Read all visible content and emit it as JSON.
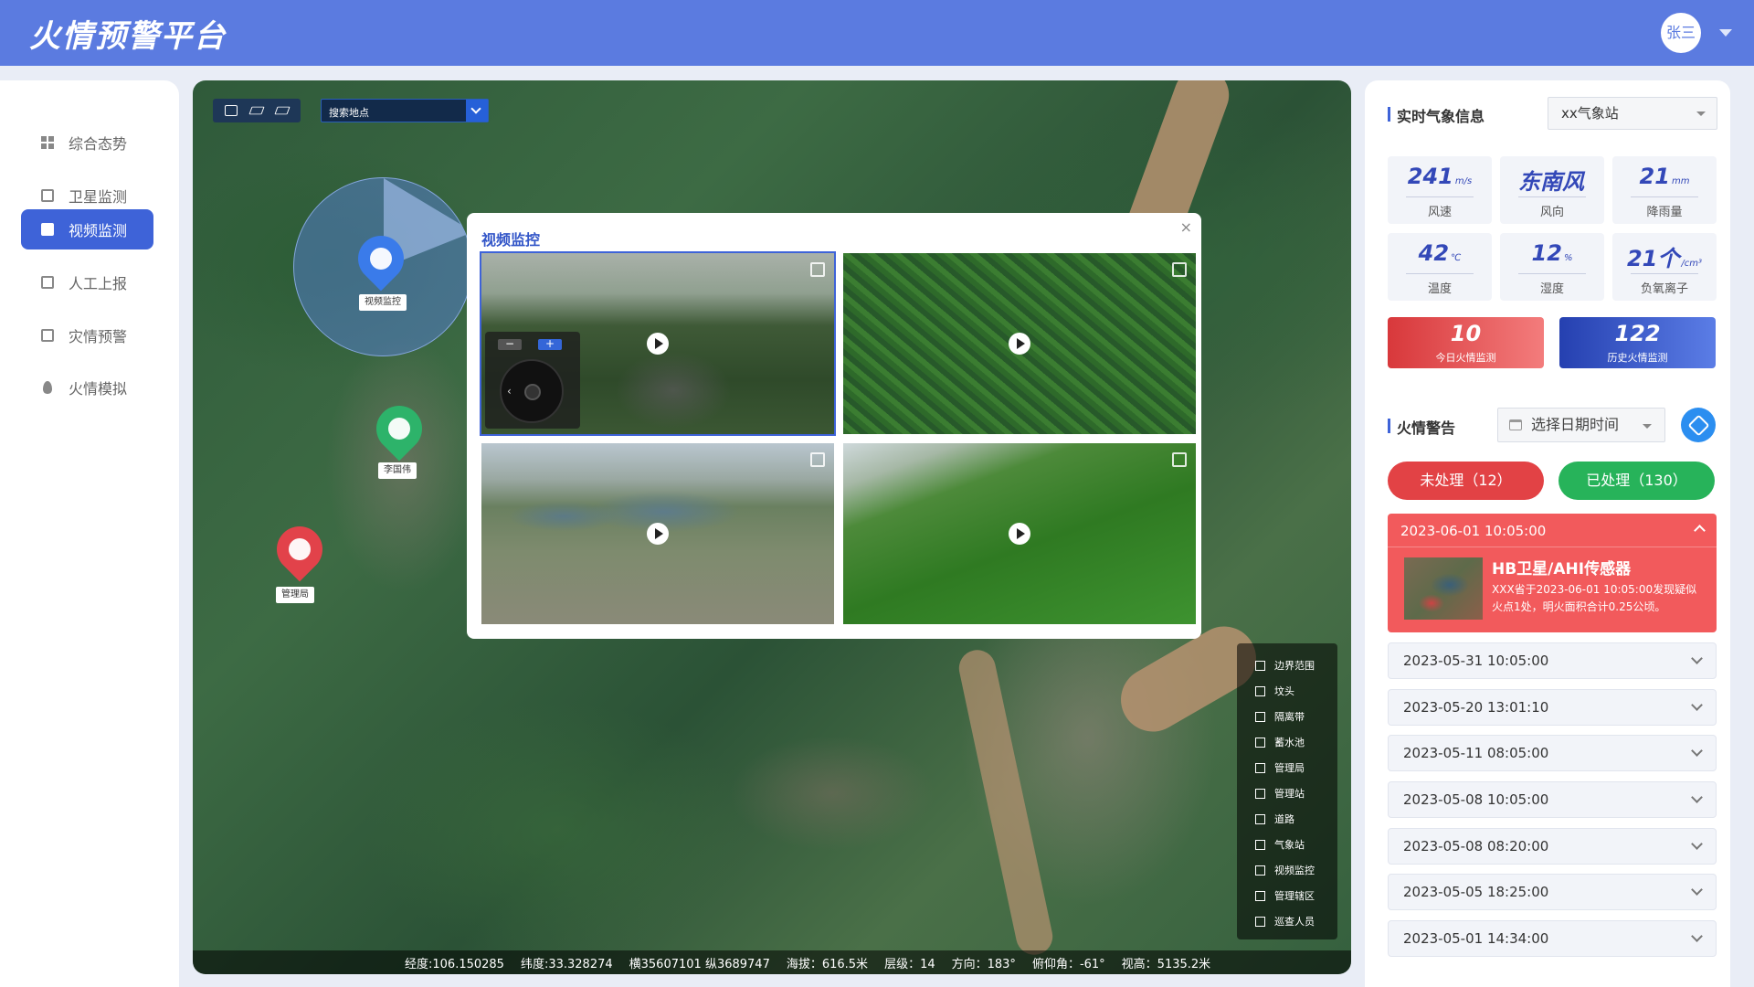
{
  "app": {
    "title": "火情预警平台"
  },
  "user": {
    "name": "张三"
  },
  "sidebar": {
    "items": [
      {
        "label": "综合态势",
        "icon": "grid-icon"
      },
      {
        "label": "卫星监测",
        "icon": "satellite-icon"
      },
      {
        "label": "视频监测",
        "icon": "video-icon",
        "active": true
      },
      {
        "label": "人工上报",
        "icon": "report-icon"
      },
      {
        "label": "灾情预警",
        "icon": "warning-icon"
      },
      {
        "label": "火情模拟",
        "icon": "flame-icon"
      }
    ]
  },
  "map": {
    "search": {
      "placeholder": "搜索地点"
    },
    "markers": [
      {
        "label": "视频监控",
        "color": "#3a7bea",
        "icon": "camera-icon"
      },
      {
        "label": "李国伟",
        "color": "#2db36a",
        "icon": "walker-icon"
      },
      {
        "label": "管理局",
        "color": "#e2424a",
        "icon": "building-icon"
      }
    ],
    "legend": [
      "边界范围",
      "坟头",
      "隔离带",
      "蓄水池",
      "管理局",
      "管理站",
      "道路",
      "气象站",
      "视频监控",
      "管理辖区",
      "巡查人员"
    ],
    "status": {
      "lng": "经度:106.150285",
      "lat": "纬度:33.328274",
      "xy": "横35607101 纵3689747",
      "altitude": "海拔：616.5米",
      "level": "层级：14",
      "direction": "方向：183°",
      "pitch": "俯仰角：-61°",
      "sight": "视高：5135.2米"
    }
  },
  "video_modal": {
    "title": "视频监控",
    "close": "×",
    "zoom_minus": "−",
    "zoom_plus": "+"
  },
  "weather": {
    "title": "实时气象信息",
    "station": "xx气象站",
    "metrics": [
      {
        "value": "241",
        "unit": "m/s",
        "label": "风速"
      },
      {
        "value": "东南风",
        "unit": "",
        "label": "风向"
      },
      {
        "value": "21",
        "unit": "mm",
        "label": "降雨量"
      },
      {
        "value": "42",
        "unit": "℃",
        "label": "温度"
      },
      {
        "value": "12",
        "unit": "%",
        "label": "湿度"
      },
      {
        "value": "21个",
        "unit": "/cm³",
        "label": "负氧离子"
      }
    ],
    "today": {
      "value": "10",
      "label": "今日火情监测"
    },
    "history": {
      "value": "122",
      "label": "历史火情监测"
    }
  },
  "fire_alert": {
    "title": "火情警告",
    "date_placeholder": "选择日期时间",
    "unprocessed": "未处理（12）",
    "processed": "已处理（130）",
    "open": {
      "time": "2023-06-01 10:05:00",
      "headline": "HB卫星/AHI传感器",
      "desc": "XXX省于2023-06-01  10:05:00发现疑似火点1处，明火面积合计0.25公顷。"
    },
    "items": [
      "2023-05-31 10:05:00",
      "2023-05-20 13:01:10",
      "2023-05-11 08:05:00",
      "2023-05-08 10:05:00",
      "2023-05-08 08:20:00",
      "2023-05-05 18:25:00",
      "2023-05-01 14:34:00"
    ]
  }
}
